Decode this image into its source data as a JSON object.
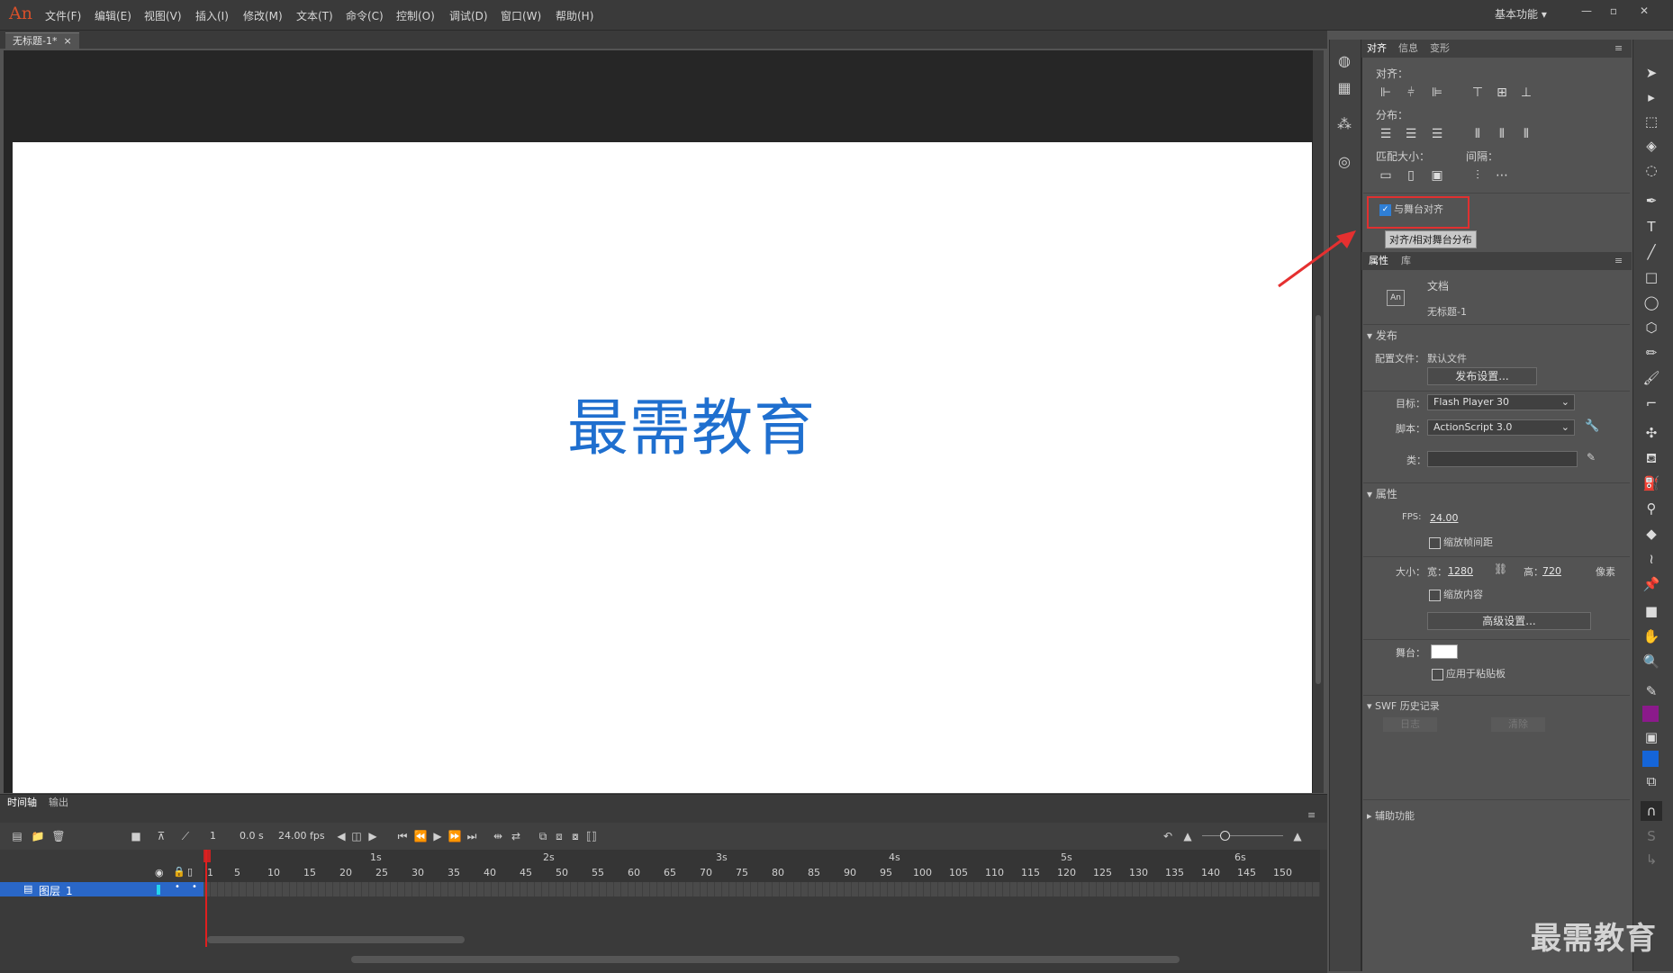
{
  "app": {
    "logo": "An"
  },
  "menu": [
    "文件(F)",
    "编辑(E)",
    "视图(V)",
    "插入(I)",
    "修改(M)",
    "文本(T)",
    "命令(C)",
    "控制(O)",
    "调试(D)",
    "窗口(W)",
    "帮助(H)"
  ],
  "workspace": "基本功能",
  "document": {
    "tab": "无标题-1*",
    "tab_close": "×"
  },
  "stage": {
    "text": "最需教育"
  },
  "align_panel": {
    "tabs": [
      "对齐",
      "信息",
      "变形"
    ],
    "align_label": "对齐：",
    "distribute_label": "分布：",
    "match_size_label": "匹配大小：",
    "spacing_label": "间隔：",
    "stage_align": "与舞台对齐",
    "stage_align_checked": true,
    "tooltip": "对齐/相对舞台分布"
  },
  "properties": {
    "tabs": [
      "属性",
      "库"
    ],
    "doc_type": "文档",
    "doc_icon": "An",
    "doc_name": "无标题-1",
    "publish_header": "发布",
    "profile_label": "配置文件：",
    "profile_value": "默认文件",
    "publish_settings_btn": "发布设置...",
    "target_label": "目标：",
    "target_value": "Flash Player 30",
    "script_label": "脚本：",
    "script_value": "ActionScript 3.0",
    "class_label": "类：",
    "props_header": "属性",
    "fps_label": "FPS:",
    "fps_value": "24.00",
    "scale_spacing": "缩放帧间距",
    "size_label": "大小：",
    "width_label": "宽：",
    "width_value": "1280",
    "height_label": "高：",
    "height_value": "720",
    "unit": "像素",
    "scale_content": "缩放内容",
    "advanced_btn": "高级设置...",
    "stage_label": "舞台：",
    "stage_color": "#ffffff",
    "apply_pasteboard": "应用于粘贴板",
    "swf_history_header": "SWF 历史记录",
    "log_btn": "日志",
    "clear_btn": "清除",
    "accessibility_header": "辅助功能"
  },
  "timeline": {
    "tabs": [
      "时间轴",
      "输出"
    ],
    "frame": "1",
    "time": "0.0 s",
    "fps": "24.00 fps",
    "seconds": [
      "1s",
      "2s",
      "3s",
      "4s",
      "5s",
      "6s"
    ],
    "frames": [
      "1",
      "5",
      "10",
      "15",
      "20",
      "25",
      "30",
      "35",
      "40",
      "45",
      "50",
      "55",
      "60",
      "65",
      "70",
      "75",
      "80",
      "85",
      "90",
      "95",
      "100",
      "105",
      "110",
      "115",
      "120",
      "125",
      "130",
      "135",
      "140",
      "145",
      "150"
    ],
    "layer_name": "图层_1"
  },
  "watermark": "最需教育",
  "colors": {
    "fill_swatch": "#8b1a8b",
    "stroke_swatch": "#1565d8",
    "accent": "#2a67c7",
    "highlight_box": "#e03030"
  }
}
